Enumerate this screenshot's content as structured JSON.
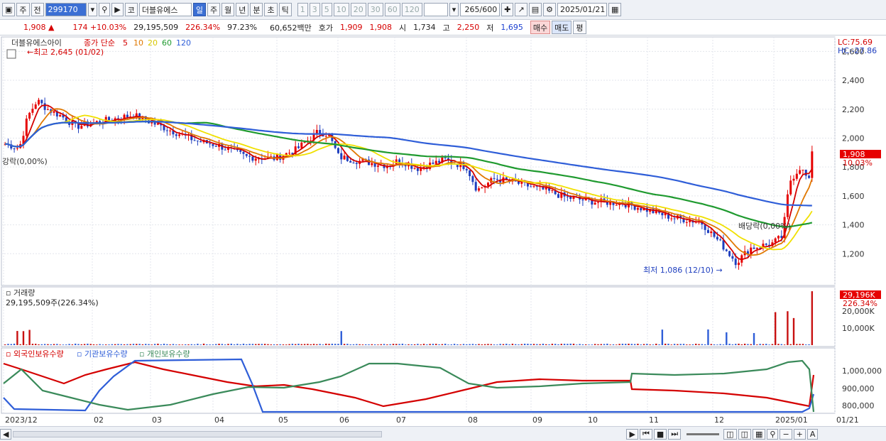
{
  "toolbar": {
    "type_label": "주",
    "market_label": "전",
    "code": "299170",
    "co_label": "코",
    "name": "더블유에스",
    "periods": [
      "일",
      "주",
      "월",
      "년",
      "분",
      "초",
      "틱"
    ],
    "active_period": "일",
    "minutes": [
      "1",
      "3",
      "5",
      "10",
      "20",
      "30",
      "60",
      "120"
    ],
    "count_value": "265",
    "count_max": "/600",
    "date": "2025/01/21"
  },
  "infobar": {
    "price": "1,908",
    "change": "174",
    "change_pct": "+10.03%",
    "volume": "29,195,509",
    "vol_ratio": "226.34%",
    "strength": "97.23%",
    "amount": "60,652백만",
    "bid_label": "호가",
    "ask1": "1,909",
    "bid1": "1,908",
    "open_label": "시",
    "open": "1,734",
    "high_label": "고",
    "high": "2,250",
    "low_label": "저",
    "low": "1,695",
    "buy_btn": "매수",
    "sell_btn": "매도",
    "eval_btn": "평"
  },
  "colors": {
    "up": "#e60000",
    "down": "#1f3fbf",
    "ma5": "#d40000",
    "ma10": "#e07800",
    "ma20": "#f0e000",
    "ma60": "#1f9a2f",
    "ma120": "#2f5ed8",
    "foreign": "#d40000",
    "inst": "#2f5ed8",
    "indiv": "#3a8a5a",
    "accent": "#3b6fd4"
  },
  "price_panel": {
    "title": "더블유에스아이",
    "ma_label": "종가 단순",
    "ma_periods": [
      "5",
      "10",
      "20",
      "60",
      "120"
    ],
    "high_note": "최고 2,645 (01/02)",
    "low_note": "최저 1,086 (12/10)",
    "left_note": "강락(0,00%)",
    "right_note": "배당락(0,00%)",
    "lc": "LC:75.69",
    "hc": "HC:-27.86",
    "y_ticks": [
      "2,600",
      "2,400",
      "2,200",
      "2,000",
      "1,800",
      "1,600",
      "1,400",
      "1,200"
    ],
    "last_price": "1,908",
    "last_pct": "10.03%"
  },
  "volume_panel": {
    "title": "거래량",
    "value": "29,195,509주(226.34%)",
    "y_ticks": [
      "20,000K",
      "10,000K"
    ],
    "last": "29,196K",
    "last_pct": "226.34%"
  },
  "holding_panel": {
    "series": [
      "외국인보유수량",
      "기관보유수량",
      "개인보유수량"
    ],
    "y_ticks": [
      "1,000,000",
      "900,000",
      "800,000"
    ]
  },
  "x_axis": [
    "2023/12",
    "02",
    "03",
    "04",
    "05",
    "06",
    "07",
    "08",
    "09",
    "10",
    "11",
    "12",
    "2025/01",
    "01/21"
  ],
  "chart_data": {
    "type": "line",
    "title": "더블유에스아이",
    "x": [
      "2023/12",
      "02",
      "03",
      "04",
      "05",
      "06",
      "07",
      "08",
      "09",
      "10",
      "11",
      "12",
      "2025/01"
    ],
    "series": [
      {
        "name": "종가",
        "values": [
          1980,
          2150,
          2120,
          1980,
          1860,
          2040,
          1840,
          1790,
          1700,
          1600,
          1540,
          1470,
          1250,
          1908
        ]
      },
      {
        "name": "60",
        "values": [
          1900,
          2060,
          2140,
          2120,
          2020,
          1940,
          1880,
          1860,
          1810,
          1750,
          1650,
          1540,
          1420,
          1430
        ]
      },
      {
        "name": "120",
        "values": [
          1900,
          1960,
          2000,
          2020,
          2040,
          2040,
          1980,
          1920,
          1860,
          1780,
          1690,
          1600,
          1540,
          1530
        ]
      }
    ],
    "ylim": [
      1086,
      2645
    ]
  }
}
